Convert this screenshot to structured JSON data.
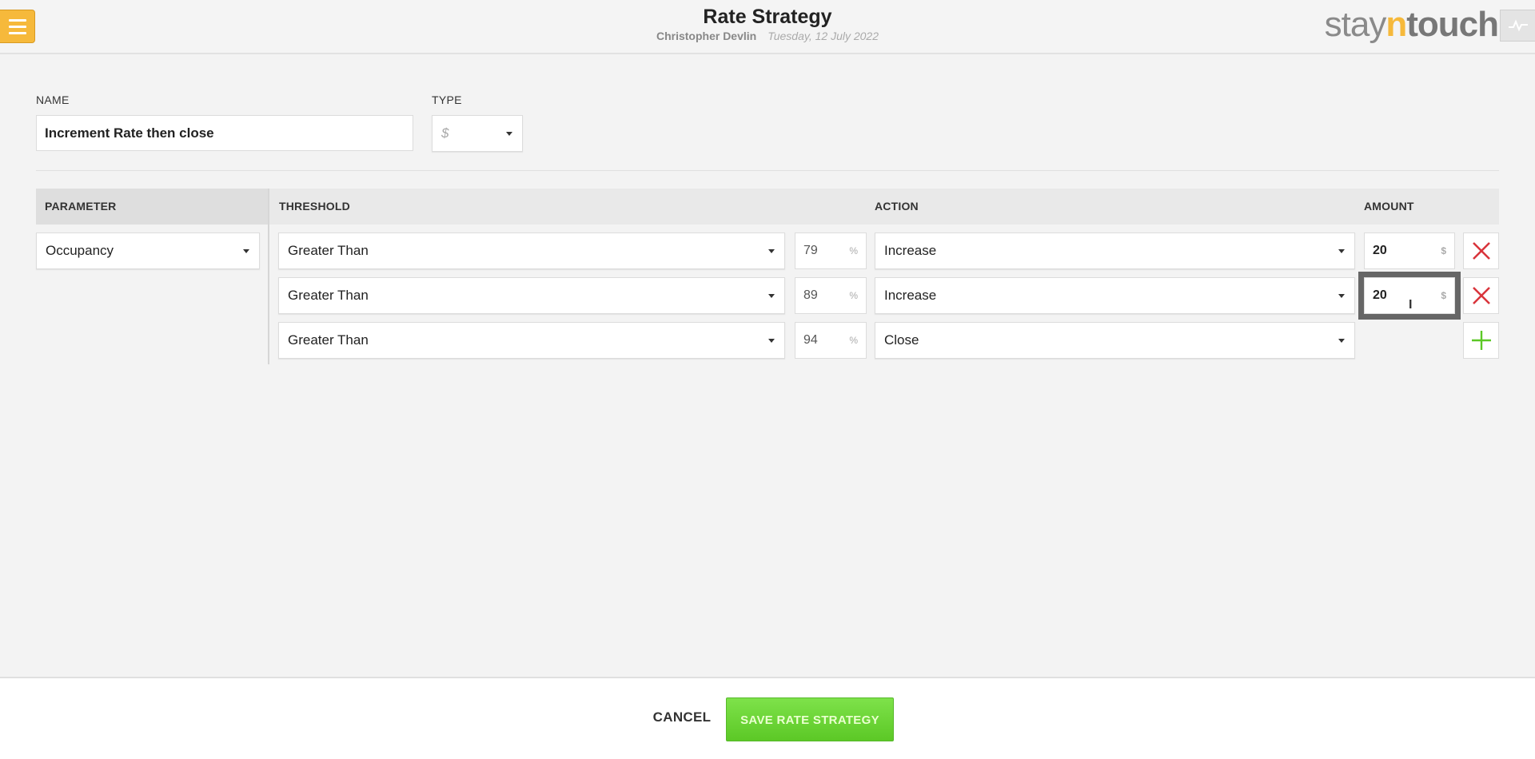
{
  "header": {
    "title": "Rate Strategy",
    "user": "Christopher Devlin",
    "date": "Tuesday, 12 July 2022",
    "brand": {
      "part1": "stay",
      "part2": "n",
      "part3": "touch"
    }
  },
  "form": {
    "name_label": "NAME",
    "name_value": "Increment Rate then close",
    "type_label": "TYPE",
    "type_value": "$"
  },
  "table": {
    "headers": {
      "parameter": "PARAMETER",
      "threshold": "THRESHOLD",
      "action": "ACTION",
      "amount": "AMOUNT"
    },
    "parameter": "Occupancy",
    "rows": [
      {
        "comparator": "Greater Than",
        "threshold": "79",
        "threshold_unit": "%",
        "action": "Increase",
        "amount": "20",
        "amount_unit": "$"
      },
      {
        "comparator": "Greater Than",
        "threshold": "89",
        "threshold_unit": "%",
        "action": "Increase",
        "amount": "20",
        "amount_unit": "$"
      },
      {
        "comparator": "Greater Than",
        "threshold": "94",
        "threshold_unit": "%",
        "action": "Close"
      }
    ]
  },
  "footer": {
    "cancel_label": "CANCEL",
    "save_label": "SAVE RATE STRATEGY"
  },
  "colors": {
    "accent_orange": "#f6b93b",
    "save_green": "#6ad436",
    "delete_red": "#d9343b",
    "add_green": "#5cc826"
  }
}
